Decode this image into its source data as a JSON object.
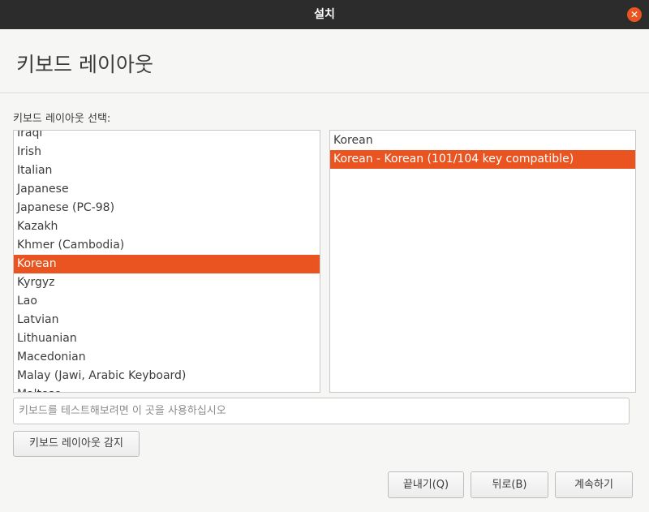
{
  "window": {
    "title": "설치",
    "close_glyph": "✕"
  },
  "header": {
    "title": "키보드 레이아웃"
  },
  "layout_section": {
    "label": "키보드 레이아웃 선택:"
  },
  "layouts": [
    {
      "label": "Iraqi",
      "selected": false
    },
    {
      "label": "Irish",
      "selected": false
    },
    {
      "label": "Italian",
      "selected": false
    },
    {
      "label": "Japanese",
      "selected": false
    },
    {
      "label": "Japanese (PC-98)",
      "selected": false
    },
    {
      "label": "Kazakh",
      "selected": false
    },
    {
      "label": "Khmer (Cambodia)",
      "selected": false
    },
    {
      "label": "Korean",
      "selected": true
    },
    {
      "label": "Kyrgyz",
      "selected": false
    },
    {
      "label": "Lao",
      "selected": false
    },
    {
      "label": "Latvian",
      "selected": false
    },
    {
      "label": "Lithuanian",
      "selected": false
    },
    {
      "label": "Macedonian",
      "selected": false
    },
    {
      "label": "Malay (Jawi, Arabic Keyboard)",
      "selected": false
    },
    {
      "label": "Maltese",
      "selected": false
    }
  ],
  "variants": [
    {
      "label": "Korean",
      "selected": false
    },
    {
      "label": "Korean - Korean (101/104 key compatible)",
      "selected": true
    }
  ],
  "test_input": {
    "value": "",
    "placeholder": "키보드를 테스트해보려면 이 곳을 사용하십시오"
  },
  "buttons": {
    "detect_label": "키보드 레이아웃 감지",
    "quit_label": "끝내기(Q)",
    "back_label": "뒤로(B)",
    "continue_label": "계속하기"
  },
  "colors": {
    "accent": "#e95420",
    "titlebar": "#2c2c2c"
  }
}
